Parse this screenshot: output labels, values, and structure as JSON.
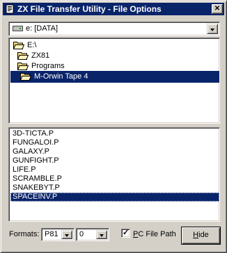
{
  "window": {
    "title": "ZX File Transfer Utility - File Options"
  },
  "drive_select": {
    "value": "e: [DATA]"
  },
  "folder_tree": {
    "items": [
      {
        "label": "E:\\",
        "open": true
      },
      {
        "label": "ZX81",
        "open": true
      },
      {
        "label": "Programs",
        "open": true
      },
      {
        "label": "M-Orwin Tape 4",
        "open": true,
        "selected": true
      }
    ]
  },
  "file_list": {
    "items": [
      "3D-TICTA.P",
      "FUNGALOI.P",
      "GALAXY.P",
      "GUNFIGHT.P",
      "LIFE.P",
      "SCRAMBLE.P",
      "SNAKEBYT.P",
      "SPACEINV.P"
    ],
    "selected": "SPACEINV.P"
  },
  "footer": {
    "formats_label": "Formats:",
    "format_value": "P81",
    "index_value": "0",
    "pc_path_checked": true,
    "pc_path_label_accel": "P",
    "pc_path_label_rest": "C File Path",
    "hide_accel": "H",
    "hide_rest": "ide"
  },
  "colors": {
    "selection": "#0a246a",
    "face": "#d4d0c8",
    "folder": "#f0d878"
  }
}
